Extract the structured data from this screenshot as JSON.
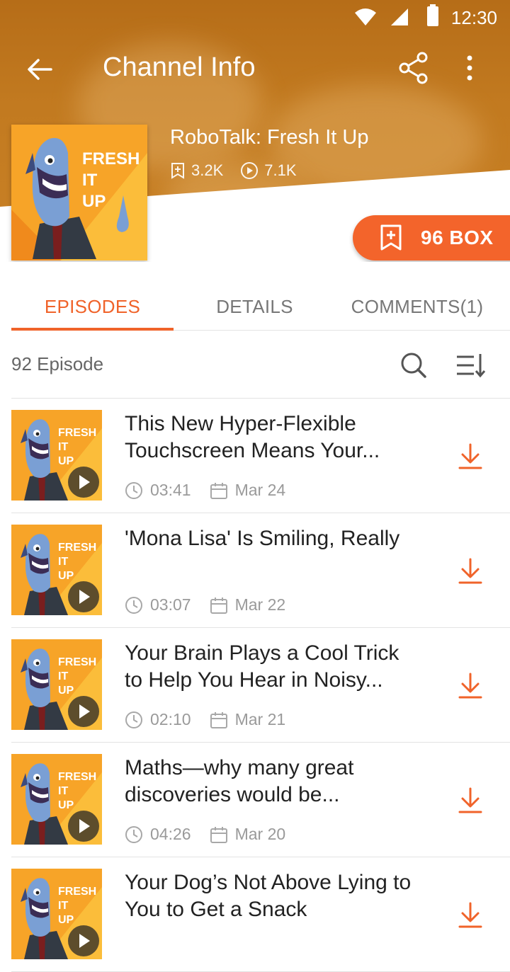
{
  "status": {
    "time": "12:30"
  },
  "toolbar": {
    "title": "Channel Info",
    "back_icon": "back-arrow-icon",
    "share_icon": "share-icon",
    "more_icon": "more-vert-icon"
  },
  "channel": {
    "name": "RoboTalk: Fresh It Up",
    "cover_text": [
      "FRESH",
      "IT",
      "UP"
    ],
    "subscribers": "3.2K",
    "plays": "7.1K"
  },
  "box_button": {
    "label": "96 BOX"
  },
  "tabs": [
    {
      "label": "EPISODES"
    },
    {
      "label": "DETAILS"
    },
    {
      "label": "COMMENTS(1)"
    }
  ],
  "episodes": {
    "count_label": "92 Episode",
    "items": [
      {
        "title": "This New Hyper-Flexible Touchscreen Means Your...",
        "duration": "03:41",
        "date": "Mar 24"
      },
      {
        "title": "'Mona Lisa' Is Smiling, Really",
        "duration": "03:07",
        "date": "Mar 22"
      },
      {
        "title": "Your Brain Plays a Cool Trick to Help You Hear in Noisy...",
        "duration": "02:10",
        "date": "Mar 21"
      },
      {
        "title": "Maths—why many great discoveries would be...",
        "duration": "04:26",
        "date": "Mar 20"
      },
      {
        "title": "Your Dog’s Not Above Lying to You to Get a Snack",
        "duration": "",
        "date": ""
      }
    ]
  },
  "colors": {
    "accent": "#f0632a",
    "header": "#c27a20",
    "cover_bg": "#f7a428"
  }
}
